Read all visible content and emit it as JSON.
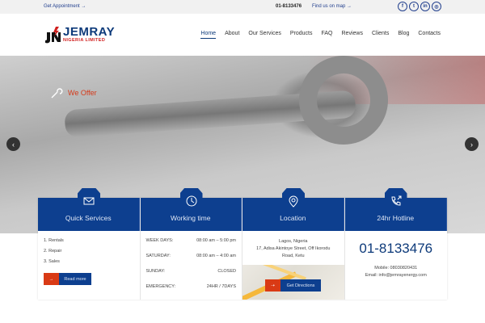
{
  "topbar": {
    "appointment": "Get Appointment →",
    "phone": "01-8133476",
    "map": "Find us on map →",
    "social": [
      "f",
      "t",
      "in",
      "◎"
    ]
  },
  "logo": {
    "name": "JEMRAY",
    "sub": "NIGERIA LIMITED"
  },
  "nav": [
    "Home",
    "About",
    "Our Services",
    "Products",
    "FAQ",
    "Reviews",
    "Clients",
    "Blog",
    "Contacts"
  ],
  "hero": {
    "offer": "We Offer",
    "prev": "‹",
    "next": "›"
  },
  "cards": {
    "quick": {
      "title": "Quick Services",
      "items": [
        "1.  Rentals",
        "2.  Repair",
        "3.  Sales"
      ],
      "button": "Read more"
    },
    "working": {
      "title": "Working time",
      "rows": [
        [
          "WEEK DAYS:",
          "08:00 am – 5:00 pm"
        ],
        [
          "SATURDAY:",
          "08:00 am – 4:00 am"
        ],
        [
          "SUNDAY:",
          "CLOSED"
        ],
        [
          "EMERGENCY:",
          "24HR / 7DAYS"
        ]
      ]
    },
    "location": {
      "title": "Location",
      "line1": "Lagos, Nigeria",
      "line2": "17, Adisa Akintoye Street, Off Ikorodu Road, Ketu",
      "button": "Get Directions"
    },
    "hotline": {
      "title": "24hr Hotline",
      "number": "01-8133476",
      "mobile": "Mobile: 08030820431",
      "email": "Email: info@jemrayenergy.com"
    }
  },
  "colors": {
    "primary": "#0d3f8f",
    "accent": "#d93a15"
  }
}
